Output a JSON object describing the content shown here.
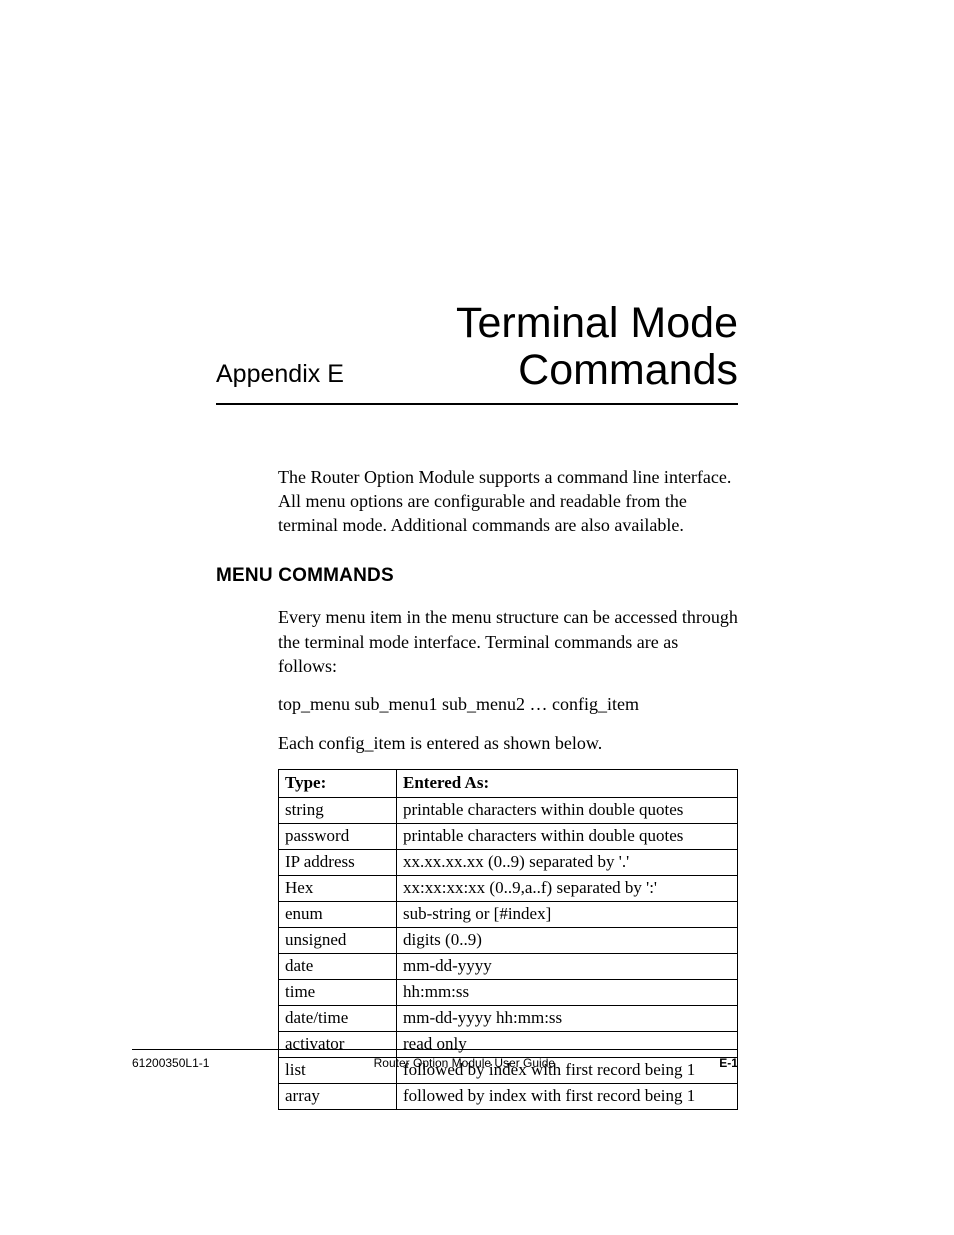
{
  "header": {
    "appendix_label": "Appendix E",
    "title_line1": "Terminal Mode",
    "title_line2": "Commands"
  },
  "intro": "The Router Option Module supports a command line interface. All menu options are configurable and readable from the terminal mode. Additional commands are also available.",
  "section1": {
    "heading": "MENU COMMANDS",
    "para1": "Every menu item in the menu structure can be accessed through the terminal mode interface.  Terminal commands are as follows:",
    "para2": "top_menu sub_menu1 sub_menu2 … config_item",
    "para3": "Each config_item is entered as shown below."
  },
  "table": {
    "headers": [
      "Type:",
      "Entered As:"
    ],
    "rows": [
      [
        "string",
        "printable characters within double quotes"
      ],
      [
        "password",
        "printable characters within double quotes"
      ],
      [
        "IP address",
        "xx.xx.xx.xx (0..9) separated by '.'"
      ],
      [
        "Hex",
        "xx:xx:xx:xx (0..9,a..f) separated by ':'"
      ],
      [
        "enum",
        "sub-string or [#index]"
      ],
      [
        "unsigned",
        "digits (0..9)"
      ],
      [
        "date",
        "mm-dd-yyyy"
      ],
      [
        "time",
        "hh:mm:ss"
      ],
      [
        "date/time",
        "mm-dd-yyyy hh:mm:ss"
      ],
      [
        "activator",
        "read only"
      ],
      [
        "list",
        "followed by index with first record being 1"
      ],
      [
        "array",
        "followed by index with first record being 1"
      ]
    ]
  },
  "footer": {
    "left": "61200350L1-1",
    "center": "Router Option Module User Guide",
    "right": "E-1"
  }
}
